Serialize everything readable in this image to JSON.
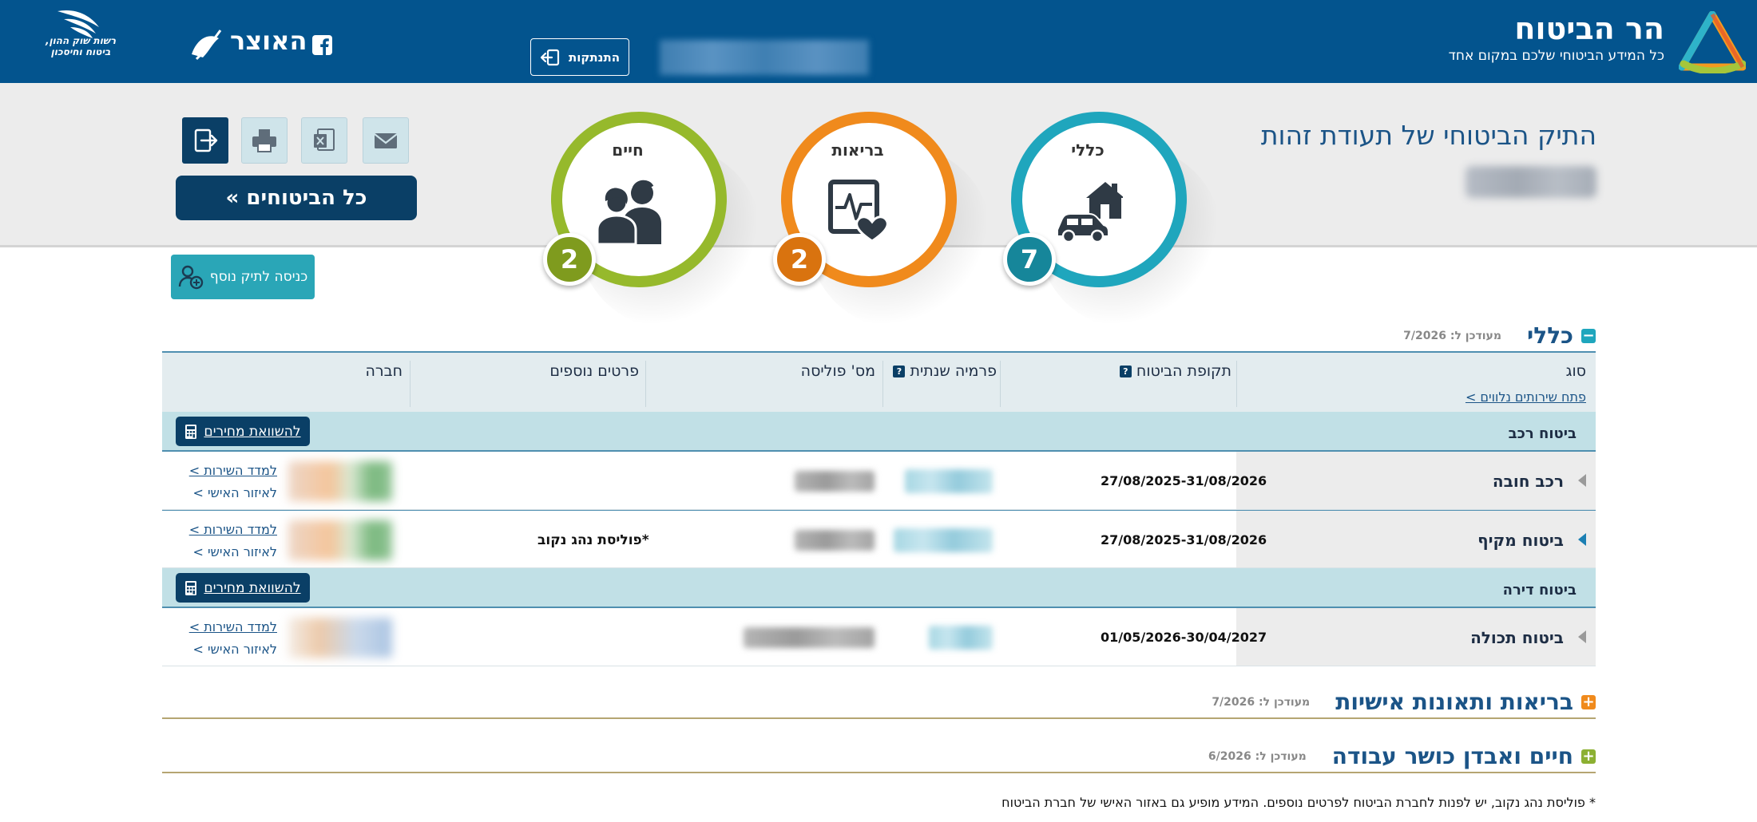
{
  "header": {
    "brand_title": "הר הביטוח",
    "brand_subtitle": "כל המידע הביטוחי שלכם במקום אחד",
    "logout_label": "התנתקות",
    "facebook_icon": "facebook-icon",
    "otzar_logo_text": "האוצר",
    "regulator_text": "רשות שוק ההון, ביטוח וחיסכון",
    "colors": {
      "bar": "#03548e"
    }
  },
  "portfolio": {
    "title": "התיק הביטוחי של תעודת זהות"
  },
  "categories": [
    {
      "label": "כללי",
      "count": "7",
      "color": "#1fa6bd",
      "badge_color": "#16869a",
      "icon": "car-house-icon"
    },
    {
      "label": "בריאות",
      "count": "2",
      "color": "#f08a1c",
      "badge_color": "#d9730f",
      "icon": "health-heart-icon"
    },
    {
      "label": "חיים",
      "count": "2",
      "color": "#96b92c",
      "badge_color": "#7f9b1e",
      "icon": "people-icon"
    }
  ],
  "toolbar": {
    "email_icon": "email-icon",
    "excel_icon": "excel-icon",
    "print_icon": "print-icon",
    "exit_icon": "exit-icon",
    "all_policies_label": "כל הביטוחים »",
    "another_portfolio_label": "כניסה לתיק נוסף"
  },
  "general_section": {
    "title": "כללי",
    "updated": "מעודכן ל: 7/2026",
    "toggle": "−",
    "columns": {
      "type": "סוג",
      "type_link": "פתח שירותים נלווים >",
      "period": "תקופת הביטוח",
      "premium": "פרמיה שנתית",
      "policy": "מס' פוליסה",
      "extra": "פרטים נוספים",
      "company": "חברה",
      "help": "?"
    },
    "groups": [
      {
        "label": "ביטוח רכב",
        "compare_label": "להשוואת מחירים",
        "rows": [
          {
            "type": "רכב חובה",
            "period": "27/08/2025-31/08/2026",
            "extra": "",
            "link_service": "למדד השירות >",
            "link_personal": "לאיזור האישי >",
            "expanded": false
          },
          {
            "type": "ביטוח מקיף",
            "period": "27/08/2025-31/08/2026",
            "extra": "*פוליסת נהג נקוב",
            "link_service": "למדד השירות >",
            "link_personal": "לאיזור האישי >",
            "expanded": true
          }
        ]
      },
      {
        "label": "ביטוח דירה",
        "compare_label": "להשוואת מחירים",
        "rows": [
          {
            "type": "ביטוח תכולה",
            "period": "01/05/2026-30/04/2027",
            "extra": "",
            "link_service": "למדד השירות >",
            "link_personal": "לאיזור האישי >",
            "expanded": false
          }
        ]
      }
    ]
  },
  "health_section": {
    "title": "בריאות ותאונות אישיות",
    "updated": "מעודכן ל: 7/2026",
    "toggle": "+",
    "color": "#f08a1c"
  },
  "life_section": {
    "title": "חיים ואבדן כושר עבודה",
    "updated": "מעודכן ל: 6/2026",
    "toggle": "+",
    "color": "#8cb032"
  },
  "footnote": "* פוליסת נהג נקוב, יש לפנות לחברת הביטוח לפרטים נוספים. המידע מופיע גם באזור האישי של חברת הביטוח"
}
